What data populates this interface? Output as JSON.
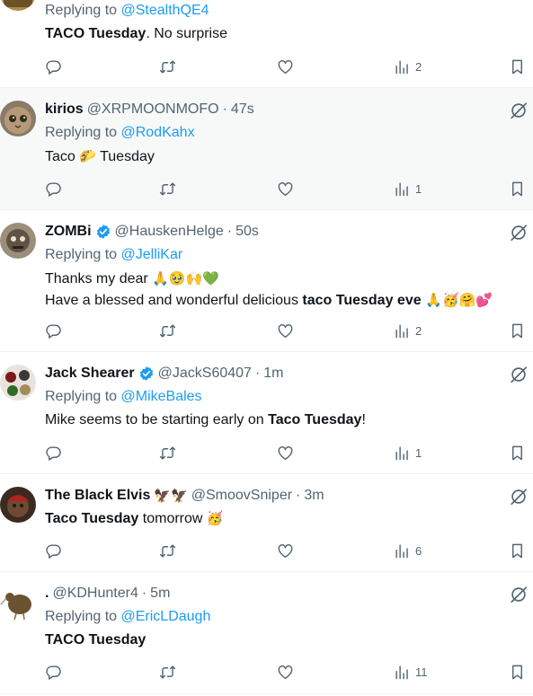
{
  "posts": [
    {
      "replying_prefix": "Replying to",
      "replying_to": "@StealthQE4",
      "text_bold": "TACO Tuesday",
      "text_rest": ". No surprise",
      "views": "2"
    },
    {
      "name": "kirios",
      "handle": "@XRPMOONMOFO",
      "time": "47s",
      "replying_prefix": "Replying to",
      "replying_to": "@RodKahx",
      "text_a": "Taco",
      "emoji": "🌮",
      "text_b": "Tuesday",
      "views": "1"
    },
    {
      "name": "ZOMBi",
      "handle": "@HauskenHelge",
      "time": "50s",
      "replying_prefix": "Replying to",
      "replying_to": "@JelliKar",
      "line1": "Thanks my dear",
      "line1_emoji": "🙏🥹🙌💚",
      "line2_a": "Have a blessed and wonderful delicious ",
      "line2_bold": "taco Tuesday eve",
      "line2_emoji": " 🙏🥳🤗💕",
      "views": "2"
    },
    {
      "name": "Jack Shearer",
      "handle": "@JackS60407",
      "time": "1m",
      "replying_prefix": "Replying to",
      "replying_to": "@MikeBales",
      "text_a": "Mike seems to be starting early on ",
      "text_bold": "Taco Tuesday",
      "text_b": "!",
      "views": "1"
    },
    {
      "name": "The Black Elvis",
      "name_emoji": "🦅🦅",
      "handle": "@SmoovSniper",
      "time": "3m",
      "text_bold": "Taco Tuesday",
      "text_b": " tomorrow",
      "emoji": "🥳",
      "views": "6"
    },
    {
      "name": ".",
      "handle": "@KDHunter4",
      "time": "5m",
      "replying_prefix": "Replying to",
      "replying_to": "@EricLDaugh",
      "text_bold": "TACO Tuesday",
      "views": "11"
    }
  ],
  "separator": "·",
  "colors": {
    "text": "#0f1419",
    "secondary": "#536471",
    "link": "#1d9bf0",
    "verified": "#1d9bf0",
    "highlight_bg": "#f7f9f9",
    "divider": "#eff3f4"
  },
  "icons": [
    "reply-icon",
    "retweet-icon",
    "like-icon",
    "views-icon",
    "bookmark-icon",
    "mute-icon",
    "verified-badge-icon"
  ]
}
